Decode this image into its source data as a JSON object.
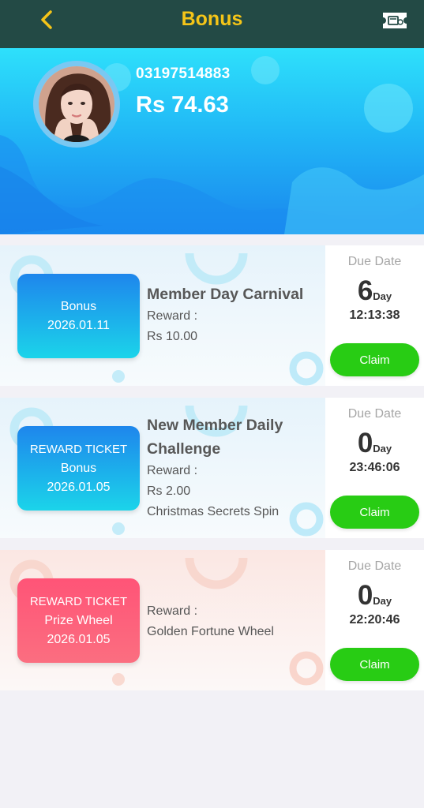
{
  "header": {
    "title": "Bonus",
    "back_icon": "chevron-left-icon",
    "ticket_icon": "ticket-icon",
    "title_color": "#f5c518",
    "background": "#234a45"
  },
  "profile": {
    "phone": "03197514883",
    "balance": "Rs 74.63"
  },
  "cards": [
    {
      "badge": {
        "lines": [
          "Bonus",
          "2026.01.11"
        ],
        "color": "blue"
      },
      "title": "Member Day Carnival",
      "reward_label": "Reward :",
      "reward_lines": [
        "Rs 10.00"
      ],
      "due_label": "Due Date",
      "days": "6",
      "day_unit": "Day",
      "time": "12:13:38",
      "claim_label": "Claim"
    },
    {
      "badge": {
        "lines": [
          "REWARD TICKET",
          "Bonus",
          "2026.01.05"
        ],
        "color": "blue"
      },
      "title_lines": [
        "New Member Daily",
        "Challenge"
      ],
      "reward_label": "Reward :",
      "reward_lines": [
        "Rs 2.00",
        "Christmas Secrets Spin"
      ],
      "due_label": "Due Date",
      "days": "0",
      "day_unit": "Day",
      "time": "23:46:06",
      "claim_label": "Claim"
    },
    {
      "badge": {
        "lines": [
          "REWARD TICKET",
          "Prize Wheel",
          "2026.01.05"
        ],
        "color": "pink"
      },
      "reward_label": "Reward :",
      "reward_lines": [
        "Golden Fortune Wheel"
      ],
      "due_label": "Due Date",
      "days": "0",
      "day_unit": "Day",
      "time": "22:20:46",
      "claim_label": "Claim"
    }
  ],
  "colors": {
    "claim_button": "#28cc14",
    "badge_blue": "#1e86ec",
    "badge_pink": "#ff5477"
  }
}
